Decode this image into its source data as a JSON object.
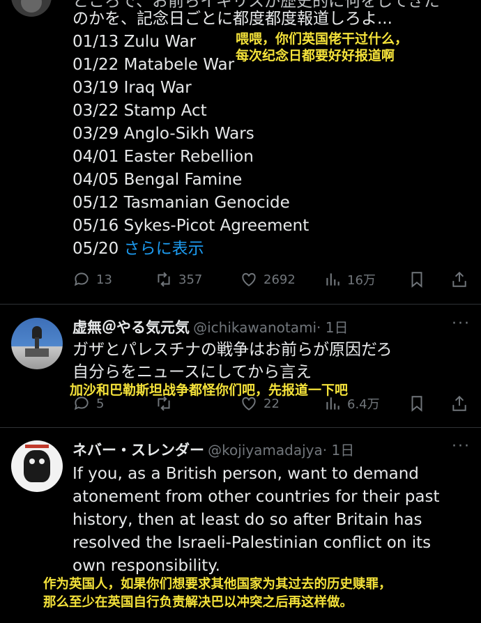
{
  "tweet1": {
    "intro_partial": "ところで、お前らイギリスが歴史的に何をしてきた",
    "intro": "のかを、記念日ごとに都度都度報道しろよ...",
    "events": [
      "01/13 Zulu War",
      "01/22 Matabele War",
      "03/19 Iraq War",
      "03/22 Stamp Act",
      "03/29 Anglo-Sikh Wars",
      "04/01 Easter Rebellion",
      "04/05 Bengal Famine",
      "05/12 Tasmanian Genocide",
      "05/16 Sykes-Picot Agreement"
    ],
    "last_date": "05/20",
    "show_more": "さらに表示",
    "subtitle_line1": "喂喂，你们英国佬干过什么，",
    "subtitle_line2": "每次纪念日都要好好报道啊",
    "actions": {
      "replies": "13",
      "retweets": "357",
      "likes": "2692",
      "views": "16万"
    }
  },
  "tweet2": {
    "name": "虚無＠やる気元気",
    "handle": "@ichikawanotami",
    "time": "· 1日",
    "line1": "ガザとパレスチナの戦争はお前らが原因だろ",
    "line2": "自分らをニュースにしてから言え",
    "subtitle": "加沙和巴勒斯坦战争都怪你们吧，先报道一下吧",
    "actions": {
      "replies": "5",
      "retweets": "",
      "likes": "22",
      "views": "6.4万"
    }
  },
  "tweet3": {
    "name": "ネバー・スレンダー",
    "handle": "@kojiyamadajya",
    "time": "· 1日",
    "lines": [
      "If you, as a British person, want to demand",
      "atonement from other countries for their past",
      "history, then at least do so after Britain has",
      "resolved the Israeli-Palestinian conflict on its",
      "own responsibility."
    ],
    "subtitle_line1": "作为英国人，如果你们想要求其他国家为其过去的历史赎罪，",
    "subtitle_line2": "那么至少在英国自行负责解决巴以冲突之后再这样做。"
  },
  "icons": [
    "reply-icon",
    "retweet-icon",
    "like-icon",
    "views-icon",
    "bookmark-icon",
    "share-icon",
    "more-icon"
  ],
  "colors": {
    "background": "#000000",
    "text": "#e7e9ea",
    "muted": "#71767b",
    "link": "#1d9bf0",
    "subtitle": "#f4e23a"
  }
}
